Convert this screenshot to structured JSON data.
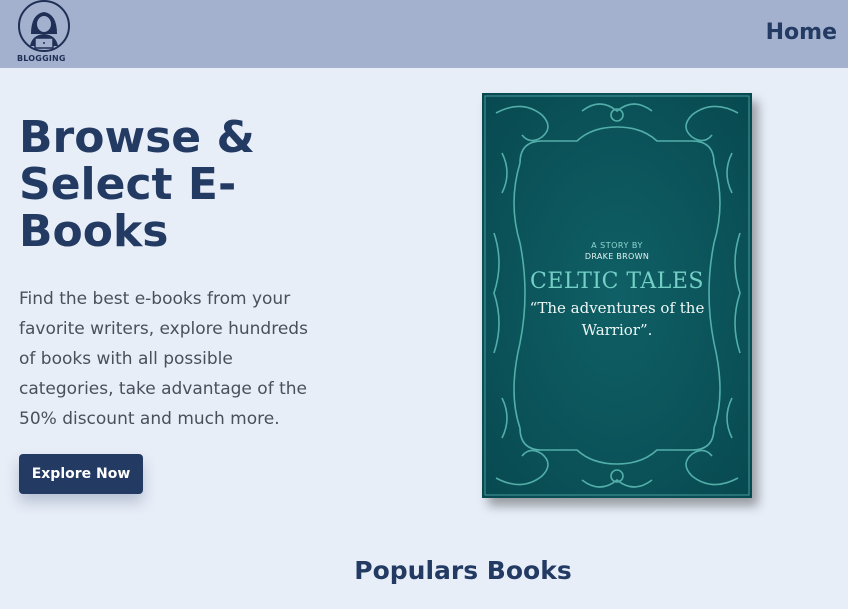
{
  "header": {
    "logo_text": "BLOGGING",
    "nav_home": "Home",
    "colors": {
      "background": "#a3b1cf",
      "text": "#233a63"
    }
  },
  "hero": {
    "title": "Browse & Select E-Books",
    "description": "Find the best e-books from your favorite writers, explore hundreds of books with all possible categories, take advantage of the 50% discount and much more.",
    "cta_label": "Explore Now"
  },
  "book": {
    "story_by": "A STORY BY",
    "author": "DRAKE BROWN",
    "title": "CELTIC TALES",
    "subtitle": "“The adventures of the Warrior”.",
    "colors": {
      "cover": "#0e5a5f",
      "ornament": "#5fbfb8"
    }
  },
  "popular": {
    "title": "Populars Books"
  },
  "icons": {
    "logo": "blogger-laptop-icon"
  },
  "colors": {
    "page_background": "#e8eef8",
    "primary": "#233a63"
  }
}
